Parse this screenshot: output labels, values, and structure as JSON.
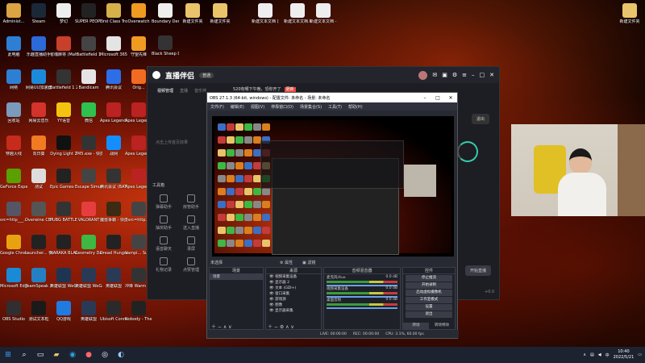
{
  "desktop_icons_col1": [
    {
      "label": "Administ...",
      "icon": "user-icon",
      "color": "#d9a441"
    },
    {
      "label": "此电脑",
      "icon": "computer-icon",
      "color": "#2d7fd3"
    },
    {
      "label": "网络",
      "icon": "network-icon",
      "color": "#2d7fd3"
    },
    {
      "label": "回收站",
      "icon": "recycle-bin-icon",
      "color": "#7a9bbb"
    },
    {
      "label": "穿越火线",
      "icon": "crossfire-icon",
      "color": "#c62b1b"
    },
    {
      "label": "GeForce Experience",
      "icon": "geforce-icon",
      "color": "#5aa000"
    },
    {
      "label": "src=http___...",
      "icon": "image-file-icon",
      "color": "#556"
    },
    {
      "label": "Google Chrome",
      "icon": "chrome-icon",
      "color": "#e8a210"
    },
    {
      "label": "Microsoft Edge",
      "icon": "edge-icon",
      "color": "#1a8ad6"
    },
    {
      "label": "OBS Studio",
      "icon": "obs-icon",
      "color": "#302e31"
    }
  ],
  "desktop_icons_col2": [
    {
      "label": "Steam",
      "icon": "steam-icon",
      "color": "#1b2838"
    },
    {
      "label": "乐趣直播助手",
      "icon": "live-helper-icon",
      "color": "#2b6ad8"
    },
    {
      "label": "网易UU加速器",
      "icon": "uu-icon",
      "color": "#1c8adb"
    },
    {
      "label": "网易云音乐",
      "icon": "netease-music-icon",
      "color": "#d2332b"
    },
    {
      "label": "向日葵",
      "icon": "sunflower-icon",
      "color": "#f07b22"
    },
    {
      "label": "测试",
      "icon": "file-icon",
      "color": "#ddd"
    },
    {
      "label": "Overwine CBT (Client...",
      "icon": "overwine-icon",
      "color": "#555"
    },
    {
      "label": "Launcher... 快捷方式",
      "icon": "launcher-icon",
      "color": "#222"
    },
    {
      "label": "TeamSpeak 3",
      "icon": "teamspeak-icon",
      "color": "#2580c3"
    },
    {
      "label": "测试文本框",
      "icon": "text-file-icon",
      "color": "#1a1a1a"
    }
  ],
  "desktop_icons_col3": [
    {
      "label": "梦幻",
      "icon": "doc-icon",
      "color": "#eee"
    },
    {
      "label": "雀魂麻将 (Mahjong...",
      "icon": "mahjong-icon",
      "color": "#c8402a"
    },
    {
      "label": "Battlefield 1 2021.exe",
      "icon": "battlefield-icon",
      "color": "#333"
    },
    {
      "label": "YY语音",
      "icon": "yy-icon",
      "color": "#f2c40f"
    },
    {
      "label": "Dying Light 2",
      "icon": "dyinglight-icon",
      "color": "#111"
    },
    {
      "label": "Epic Games Launcher",
      "icon": "epic-icon",
      "color": "#222"
    },
    {
      "label": "PUBG BATTLEGR...",
      "icon": "pubg-icon",
      "color": "#333"
    },
    {
      "label": "NARAKA BLADEPOI...",
      "icon": "naraka-icon",
      "color": "#222"
    },
    {
      "label": "英雄联盟 WeGame",
      "icon": "lol-icon",
      "color": "#1d3552"
    },
    {
      "label": "QQ游戏",
      "icon": "qq-game-icon",
      "color": "#1f7be0"
    }
  ],
  "desktop_icons_col4": [
    {
      "label": "SUPER PEOPLE CBT",
      "icon": "superpeople-icon",
      "color": "#222"
    },
    {
      "label": "Battlefield 1",
      "icon": "battlefield-icon",
      "color": "#444"
    },
    {
      "label": "Bandicam",
      "icon": "bandicam-icon",
      "color": "#e4e4e4"
    },
    {
      "label": "微信",
      "icon": "wechat-icon",
      "color": "#2ec14f"
    },
    {
      "label": "TM5.exe - 快捷方式",
      "icon": "tm5-icon",
      "color": "#333"
    },
    {
      "label": "Escape Simulator",
      "icon": "escape-icon",
      "color": "#444"
    },
    {
      "label": "VALORANT",
      "icon": "valorant-icon",
      "color": "#e63e3e"
    },
    {
      "label": "Geometry Dash",
      "icon": "geometry-icon",
      "color": "#3cb843"
    },
    {
      "label": "英雄联盟 WeGame",
      "icon": "lol-icon",
      "color": "#2a3a55"
    },
    {
      "label": "英雄联盟",
      "icon": "lol-icon",
      "color": "#2a3a55"
    }
  ],
  "desktop_icons_col5": [
    {
      "label": "First Class Trouble",
      "icon": "game-icon",
      "color": "#d6b14a"
    },
    {
      "label": "Microsoft 365",
      "icon": "office-icon",
      "color": "#e4e4e4"
    },
    {
      "label": "腾讯会议",
      "icon": "meeting-icon",
      "color": "#2b6ee8"
    },
    {
      "label": "Apex Legends",
      "icon": "apex-icon",
      "color": "#b22"
    },
    {
      "label": "战网",
      "icon": "battlenet-icon",
      "color": "#148eff"
    },
    {
      "label": "腾讯会议 (BATTLEG...",
      "icon": "meeting-icon",
      "color": "#333"
    },
    {
      "label": "魔兽争霸 - 快捷方式",
      "icon": "warcraft-icon",
      "color": "#3d2a12"
    },
    {
      "label": "Dread Hunger",
      "icon": "dreadhunger-icon",
      "color": "#222"
    },
    {
      "label": "英雄联盟",
      "icon": "lol-icon",
      "color": "#2a3a55"
    },
    {
      "label": "Ubisoft Connect",
      "icon": "ubisoft-icon",
      "color": "#2a2a2a"
    }
  ],
  "desktop_icons_col6": [
    {
      "label": "Overwatch",
      "icon": "overwatch-icon",
      "color": "#f09a22"
    },
    {
      "label": "守望先锋",
      "icon": "overwatch-icon",
      "color": "#f09a22"
    },
    {
      "label": "Orig...",
      "icon": "origin-icon",
      "color": "#f26b22"
    },
    {
      "label": "Apex Legen...",
      "icon": "apex-icon",
      "color": "#b22"
    },
    {
      "label": "Apex Legen...",
      "icon": "apex-icon",
      "color": "#b22"
    },
    {
      "label": "Apex Legen...",
      "icon": "apex-icon",
      "color": "#b22"
    },
    {
      "label": "src=http...",
      "icon": "image-file-icon",
      "color": "#444"
    },
    {
      "label": "Vampi... Survivo",
      "icon": "game-icon",
      "color": "#444"
    },
    {
      "label": "冲锋 Warm Snow",
      "icon": "game-icon",
      "color": "#333"
    },
    {
      "label": "Nobody - The Turna...",
      "icon": "game-icon",
      "color": "#222"
    }
  ],
  "desktop_icons_top_extra": [
    {
      "label": "Boundary Demo",
      "icon": "doc-icon",
      "color": "#eee"
    },
    {
      "label": "新建文件夹",
      "icon": "folder-icon",
      "color": "#e9c46a"
    },
    {
      "label": "新建文件夹",
      "icon": "folder-icon",
      "color": "#e9c46a"
    },
    {
      "label": "新建文本文档 (2).txt",
      "icon": "text-file-icon",
      "color": "#eee"
    },
    {
      "label": "新建文本文档.txt",
      "icon": "text-file-icon",
      "color": "#eee"
    },
    {
      "label": "新建文本文档 - 副本.txt",
      "icon": "text-file-icon",
      "color": "#eee"
    },
    {
      "label": "新建文件夹",
      "icon": "folder-icon",
      "color": "#e9c46a"
    },
    {
      "label": "Black Sheep Demo",
      "icon": "game-icon",
      "color": "#333"
    }
  ],
  "live_app": {
    "logo": "直播伴侣",
    "badge": "普通",
    "tabs": [
      "视频管理",
      "直播",
      "音乐伴"
    ],
    "marquee": "520有哪下午晚，恐你开了",
    "marquee_tag": "更新",
    "side_heading": "工具箱",
    "side_items": [
      "弹幕助手",
      "房管助手",
      "抽奖助手",
      "送入直播",
      "语音聊天",
      "录屏",
      "礼物记录",
      "点赞管理"
    ],
    "side_hint": "点击上传首页效果",
    "exit_btn": "退出",
    "start_btn": "开始直播",
    "bottom_hint": "0 开 00:0",
    "speed": "+0.0"
  },
  "obs": {
    "title": "OBS 27.1.3 (64-bit, windows) - 配置文件: 未命名 - 场景: 未命名",
    "menu": [
      "文件(F)",
      "编辑(E)",
      "视图(V)",
      "停靠窗口(D)",
      "场景集合(S)",
      "工具(T)",
      "帮助(H)"
    ],
    "scene_label": "未选择",
    "props_btn": "属性",
    "filter_btn": "滤镜",
    "scenes_header": "场景",
    "scene_item": "场景",
    "sources_header": "来源",
    "sources": [
      "视频采集设备",
      "显示器 2",
      "文本 (GDI+)",
      "窗口采集",
      "游戏源",
      "图像",
      "显示器采集"
    ],
    "mixer_header": "音频混音器",
    "mixer": [
      {
        "name": "麦克风/Aux",
        "db": "0.0 dB"
      },
      {
        "name": "视频采集设备",
        "db": "0.0 dB"
      },
      {
        "name": "桌面音频",
        "db": "0.0 dB"
      }
    ],
    "controls_header": "控件",
    "controls": [
      "停止推流",
      "开始录制",
      "启动虚拟摄像机",
      "工作室模式",
      "设置",
      "退出"
    ],
    "transitions_tab": "转场",
    "controls_tab": "转场特效",
    "status": [
      "LIVE: 00:00:00",
      "REC: 00:00:00",
      "CPU: 3.1%, 60.00 fps"
    ]
  },
  "taskbar": {
    "time": "10:40",
    "date": "2022/5/21"
  }
}
